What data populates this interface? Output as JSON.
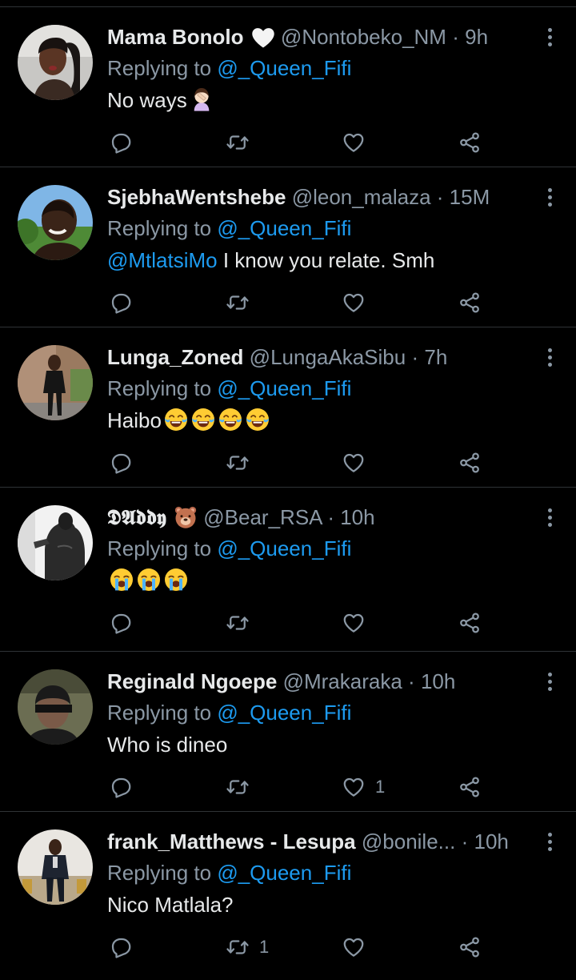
{
  "tweets": [
    {
      "name": "Mama Bonolo",
      "name_emoji": "white-heart",
      "handle": "@Nontobeko_NM",
      "time": "9h",
      "replying_prefix": "Replying to",
      "replying_to": "@_Queen_Fifi",
      "body_mention": "",
      "body": "No ways",
      "body_emojis": [
        "facepalm-emoji"
      ],
      "reply_count": "",
      "retweet_count": "",
      "like_count": ""
    },
    {
      "name": "SjebhaWentshebe",
      "name_emoji": "",
      "handle": "@leon_malaza",
      "time": "15M",
      "replying_prefix": "Replying to",
      "replying_to": "@_Queen_Fifi",
      "body_mention": "@MtlatsiMo",
      "body": " I know you relate. Smh",
      "body_emojis": [],
      "reply_count": "",
      "retweet_count": "",
      "like_count": ""
    },
    {
      "name": "Lunga_Zoned",
      "name_emoji": "",
      "handle": "@LungaAkaSibu",
      "time": "7h",
      "replying_prefix": "Replying to",
      "replying_to": "@_Queen_Fifi",
      "body_mention": "",
      "body": "Haibo",
      "body_emojis": [
        "tears-of-joy-emoji",
        "tears-of-joy-emoji",
        "tears-of-joy-emoji",
        "tears-of-joy-emoji"
      ],
      "reply_count": "",
      "retweet_count": "",
      "like_count": ""
    },
    {
      "name": "𝕯𝕬𝖉𝖉𝖞",
      "name_emoji": "bear-face",
      "handle": "@Bear_RSA",
      "time": "10h",
      "replying_prefix": "Replying to",
      "replying_to": "@_Queen_Fifi",
      "body_mention": "",
      "body": "",
      "body_emojis": [
        "loudly-crying-emoji",
        "loudly-crying-emoji",
        "loudly-crying-emoji"
      ],
      "reply_count": "",
      "retweet_count": "",
      "like_count": ""
    },
    {
      "name": "Reginald Ngoepe",
      "name_emoji": "",
      "handle": "@Mrakaraka",
      "time": "10h",
      "replying_prefix": "Replying to",
      "replying_to": "@_Queen_Fifi",
      "body_mention": "",
      "body": "Who is dineo",
      "body_emojis": [],
      "reply_count": "",
      "retweet_count": "",
      "like_count": "1"
    },
    {
      "name": "frank_Matthews - Lesupa",
      "name_emoji": "",
      "handle": "@bonile...",
      "time": "10h",
      "replying_prefix": "Replying to",
      "replying_to": "@_Queen_Fifi",
      "body_mention": "",
      "body": "Nico Matlala?",
      "body_emojis": [],
      "reply_count": "",
      "retweet_count": "1",
      "like_count": ""
    }
  ],
  "colors": {
    "background": "#000000",
    "text": "#e7e9ea",
    "secondary": "#8b98a5",
    "link": "#1d9bf0",
    "divider": "#2f3336"
  }
}
